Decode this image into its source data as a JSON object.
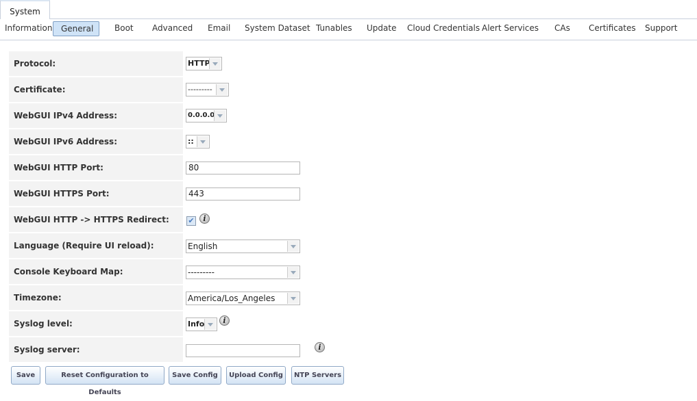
{
  "top_tab": "System",
  "subtabs": [
    "Information",
    "General",
    "Boot",
    "Advanced",
    "Email",
    "System Dataset",
    "Tunables",
    "Update",
    "Cloud Credentials",
    "Alert Services",
    "CAs",
    "Certificates",
    "Support"
  ],
  "active_subtab": "General",
  "fields": {
    "protocol": {
      "label": "Protocol:",
      "value": "HTTP"
    },
    "certificate": {
      "label": "Certificate:",
      "value": "---------"
    },
    "ipv4": {
      "label": "WebGUI IPv4 Address:",
      "value": "0.0.0.0"
    },
    "ipv6": {
      "label": "WebGUI IPv6 Address:",
      "value": "::"
    },
    "http_port": {
      "label": "WebGUI HTTP Port:",
      "value": "80"
    },
    "https_port": {
      "label": "WebGUI HTTPS Port:",
      "value": "443"
    },
    "redirect": {
      "label": "WebGUI HTTP -> HTTPS Redirect:",
      "checked": true
    },
    "language": {
      "label": "Language (Require UI reload):",
      "value": "English"
    },
    "keymap": {
      "label": "Console Keyboard Map:",
      "value": "---------"
    },
    "timezone": {
      "label": "Timezone:",
      "value": "America/Los_Angeles"
    },
    "syslog_level": {
      "label": "Syslog level:",
      "value": "Info"
    },
    "syslog_server": {
      "label": "Syslog server:",
      "value": ""
    }
  },
  "buttons": {
    "save": "Save",
    "reset": "Reset Configuration to Defaults",
    "save_config": "Save Config",
    "upload_config": "Upload Config",
    "ntp": "NTP Servers"
  },
  "info_icon": "i"
}
